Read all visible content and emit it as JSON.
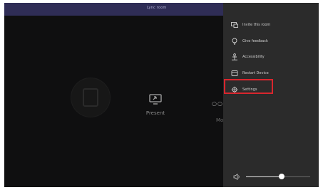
{
  "header": {
    "title": "Lync room"
  },
  "main": {
    "present_label": "Present",
    "more_label": "Mo"
  },
  "menu": {
    "items": [
      {
        "label": "Invite this room",
        "icon": "share-screen-icon"
      },
      {
        "label": "Give feedback",
        "icon": "lightbulb-icon"
      },
      {
        "label": "Accessibility",
        "icon": "accessibility-icon"
      },
      {
        "label": "Restart Device",
        "icon": "restart-icon"
      },
      {
        "label": "Settings",
        "icon": "gear-icon"
      }
    ]
  },
  "volume": {
    "level": 0.55,
    "icon": "speaker-icon"
  },
  "colors": {
    "accent": "#2f2d56",
    "highlight": "#d9262e",
    "panel": "#2b2b2b"
  }
}
